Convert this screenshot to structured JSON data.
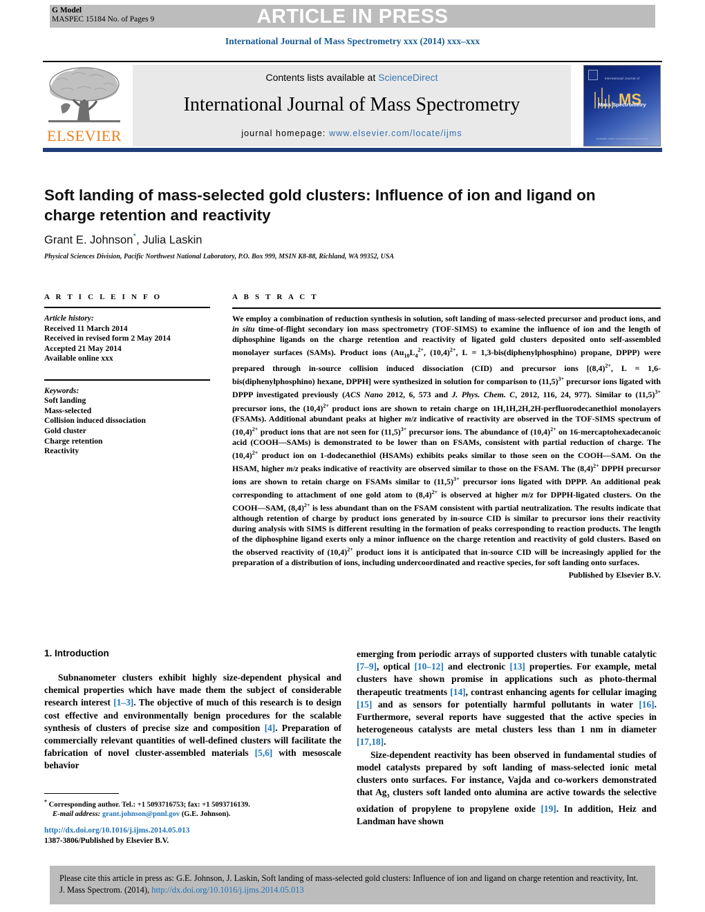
{
  "header": {
    "g_model_line1": "G Model",
    "g_model_line2": "MASPEC 15184 No. of Pages 9",
    "banner_text": "ARTICLE IN PRESS",
    "running_head": "International Journal of Mass Spectrometry xxx (2014) xxx–xxx"
  },
  "masthead": {
    "contents_prefix": "Contents lists available at ",
    "sciencedirect": "ScienceDirect",
    "journal_title": "International Journal of Mass Spectrometry",
    "homepage_label": "journal homepage: ",
    "homepage_url": "www.elsevier.com/locate/ijms",
    "publisher_wordmark": "ELSEVIER",
    "cover": {
      "top_line": "International Journal of",
      "wordmark": "Mass Spectrometry",
      "foot_line": "Available online at www.sciencedirect.com"
    },
    "accent_blue": "#1f3d7a",
    "link_blue": "#2f6fae"
  },
  "article": {
    "title": "Soft landing of mass-selected gold clusters: Influence of ion and ligand on charge retention and reactivity",
    "authors": "Grant E. Johnson",
    "authors_rest": ", Julia Laskin",
    "corresponding_marker": "*",
    "affiliation": "Physical Sciences Division, Pacific Northwest National Laboratory, P.O. Box 999, MSIN K8-88, Richland, WA 99352, USA"
  },
  "article_info": {
    "heading": "A R T I C L E   I N F O",
    "history_label": "Article history:",
    "history": [
      "Received 11 March 2014",
      "Received in revised form 2 May 2014",
      "Accepted 21 May 2014",
      "Available online xxx"
    ],
    "keywords_label": "Keywords:",
    "keywords": [
      "Soft landing",
      "Mass-selected",
      "Collision induced dissociation",
      "Gold cluster",
      "Charge retention",
      "Reactivity"
    ]
  },
  "abstract": {
    "heading": "A B S T R A C T",
    "published_by": "Published by Elsevier B.V."
  },
  "introduction": {
    "heading": "1. Introduction"
  },
  "footnote": {
    "corresponding": "Corresponding author. Tel.: +1 5093716753; fax: +1 5093716139.",
    "email_label": "E-mail address:",
    "email": "grant.johnson@pnnl.gov",
    "email_owner": "(G.E. Johnson).",
    "doi_url": "http://dx.doi.org/10.1016/j.ijms.2014.05.013",
    "issn_line": "1387-3806/Published by Elsevier B.V."
  },
  "citation": {
    "text_before_link": "Please cite this article in press as: G.E. Johnson, J. Laskin, Soft landing of mass-selected gold clusters: Influence of ion and ligand on charge retention and reactivity, Int. J. Mass Spectrom. (2014), ",
    "link": "http://dx.doi.org/10.1016/j.ijms.2014.05.013"
  }
}
